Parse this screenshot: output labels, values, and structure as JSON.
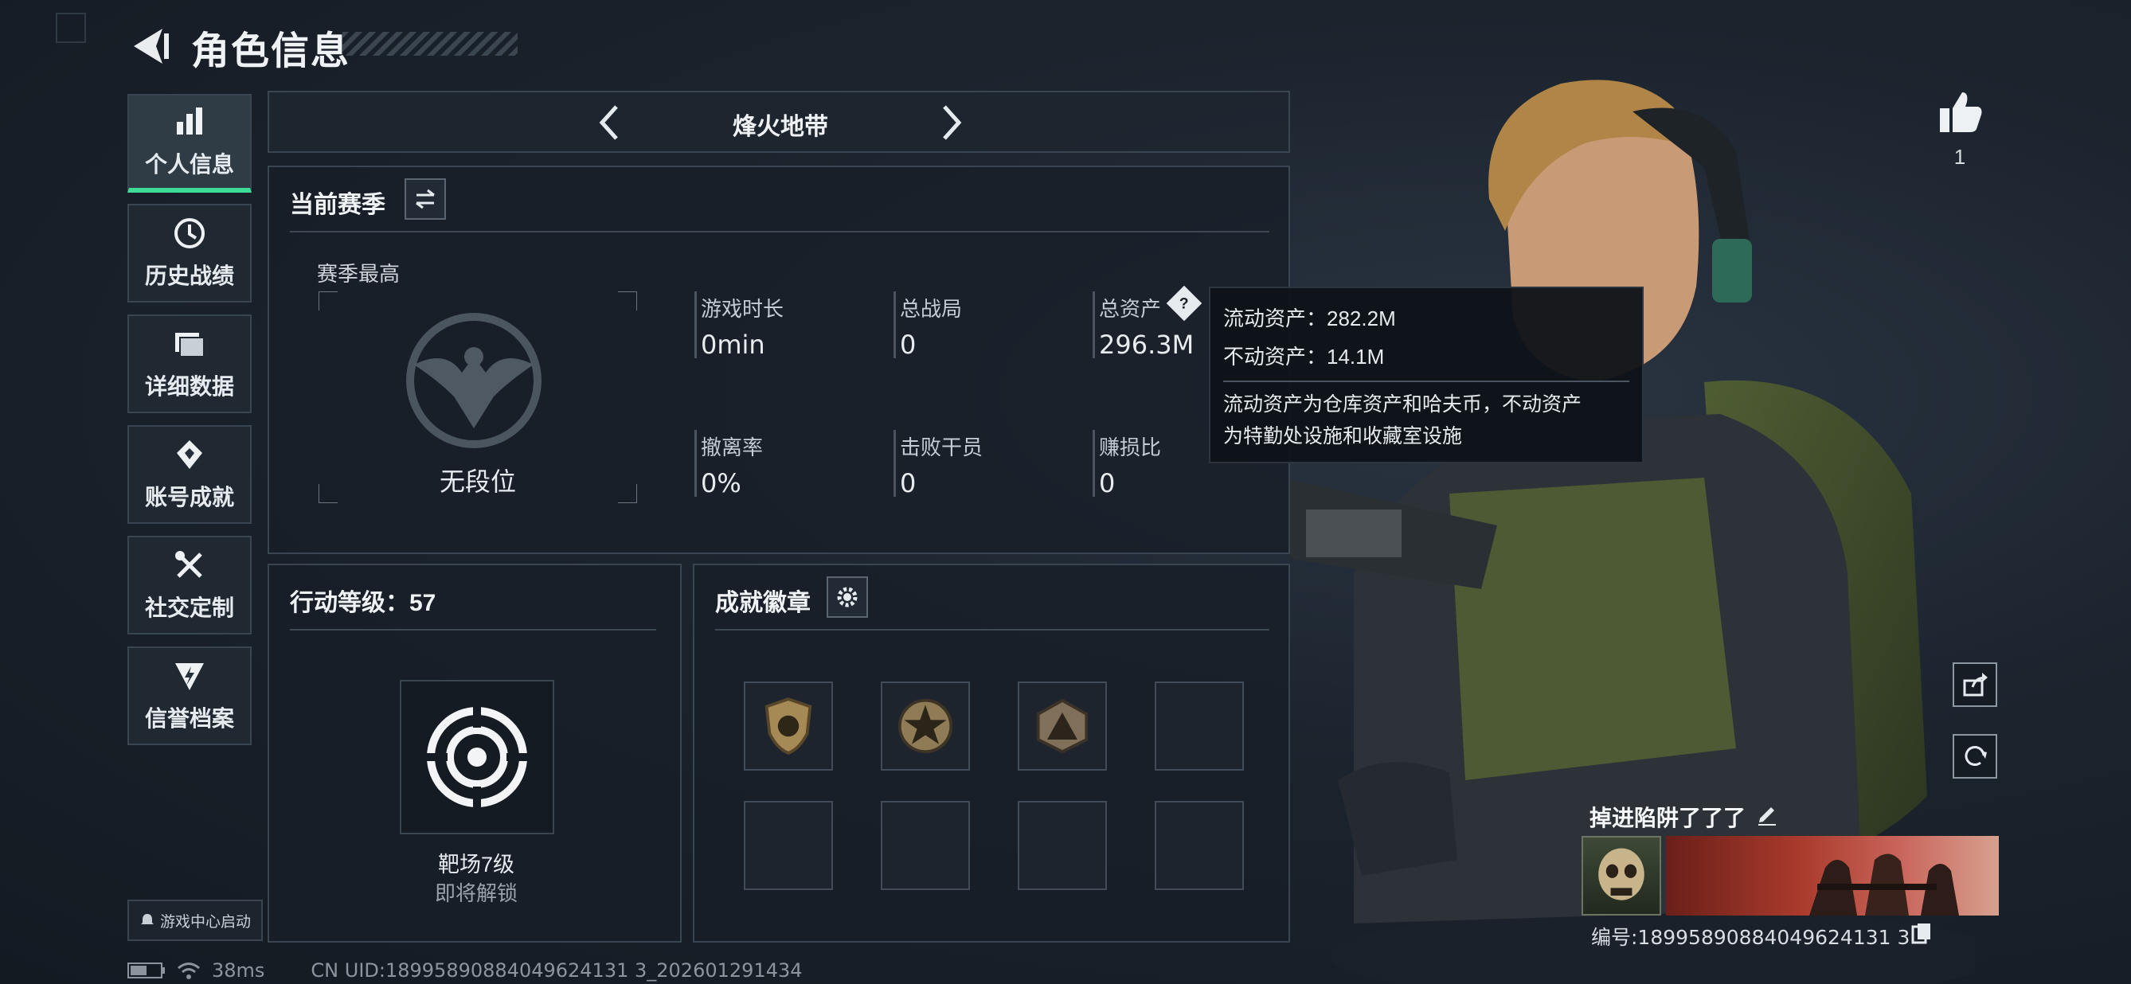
{
  "header": {
    "title": "角色信息"
  },
  "sidebar": {
    "items": [
      {
        "label": "个人信息",
        "icon": "bar-chart-icon"
      },
      {
        "label": "历史战绩",
        "icon": "history-icon"
      },
      {
        "label": "详细数据",
        "icon": "folder-icon"
      },
      {
        "label": "账号成就",
        "icon": "achievement-icon"
      },
      {
        "label": "社交定制",
        "icon": "tools-icon"
      },
      {
        "label": "信誉档案",
        "icon": "credit-icon"
      }
    ],
    "game_center": "游戏中心启动"
  },
  "mode": {
    "name": "烽火地带"
  },
  "season": {
    "title": "当前赛季",
    "best_label": "赛季最高",
    "rank": "无段位",
    "stats": [
      {
        "label": "游戏时长",
        "value": "0min"
      },
      {
        "label": "总战局",
        "value": "0"
      },
      {
        "label": "总资产",
        "value": "296.3M"
      },
      {
        "label": "撤离率",
        "value": "0%"
      },
      {
        "label": "击败干员",
        "value": "0"
      },
      {
        "label": "赚损比",
        "value": "0"
      }
    ]
  },
  "tooltip": {
    "line1": "流动资产：282.2M",
    "line2": "不动资产：14.1M",
    "desc1": "流动资产为仓库资产和哈夫币，不动资产",
    "desc2": "为特勤处设施和收藏室设施"
  },
  "level": {
    "title": "行动等级：57",
    "reward_name": "靶场7级",
    "reward_status": "即将解锁"
  },
  "badges": {
    "title": "成就徽章"
  },
  "player": {
    "likes": "1",
    "name": "掉进陷阱了了了",
    "id": "编号:18995890884049624131 3"
  },
  "status": {
    "ping": "38ms",
    "uid": "CN UID:18995890884049624131 3_202601291434"
  },
  "colors": {
    "accent": "#3ddc97",
    "panel_border": "#3a4552"
  }
}
